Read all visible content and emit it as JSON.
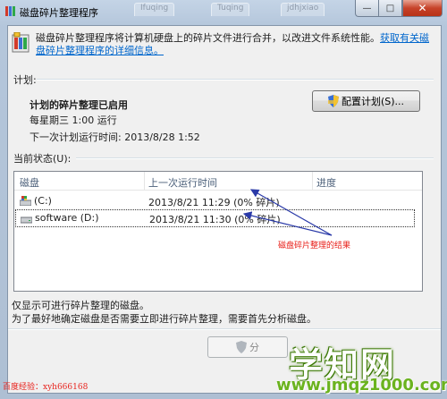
{
  "window": {
    "title": "磁盘碎片整理程序",
    "background_tabs": [
      "Ifuqing",
      "Tuqing",
      "jdhjxiao"
    ],
    "close_glyph": "✕",
    "min_glyph": "—",
    "max_glyph": "□"
  },
  "description": {
    "text": "磁盘碎片整理程序将计算机硬盘上的碎片文件进行合并，以改进文件系统性能。",
    "link": "获取有关磁盘碎片整理程序的详细信息。"
  },
  "schedule": {
    "section_label": "计划:",
    "status": "计划的碎片整理已启用",
    "frequency": "每星期三 1:00 运行",
    "next_run": "下一次计划运行时间: 2013/8/28 1:52",
    "config_button": "配置计划(S)..."
  },
  "current_status": {
    "section_label": "当前状态(U):",
    "columns": [
      "磁盘",
      "上一次运行时间",
      "进度"
    ],
    "rows": [
      {
        "disk": "(C:)",
        "last_run": "2013/8/21 11:29 (0% 碎片)",
        "progress": ""
      },
      {
        "disk": "software (D:)",
        "last_run": "2013/8/21 11:30 (0% 碎片)",
        "progress": ""
      }
    ]
  },
  "annotation": "磁盘碎片整理的结果",
  "notes": [
    "仅显示可进行碎片整理的磁盘。",
    "为了最好地确定磁盘是否需要立即进行碎片整理，需要首先分析磁盘。"
  ],
  "analyze_button": "分",
  "credit": "百度经验：xyh666168",
  "watermark": {
    "big": "学知网",
    "url": "www.jmqz1000.com"
  },
  "colors": {
    "annotation": "#e8201a",
    "arrow": "#2a3aa8",
    "link": "#0066cc",
    "watermark": "#6bb31f"
  },
  "icons": [
    "defrag-app-icon",
    "shield-icon",
    "system-drive-icon",
    "hard-drive-icon"
  ]
}
